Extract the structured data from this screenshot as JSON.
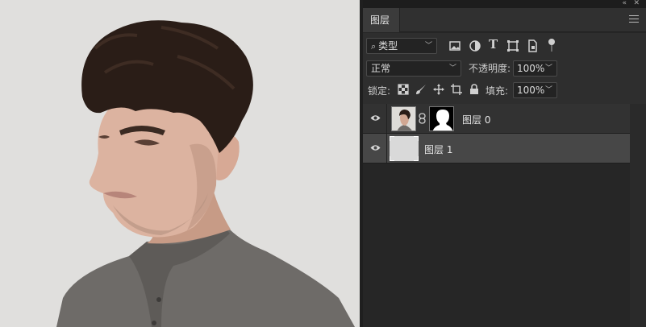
{
  "canvas": {
    "background_color": "#e0dfdd",
    "image_subject": "portrait-photo"
  },
  "panel": {
    "header": {
      "collapse_glyph": "«",
      "close_glyph": "✕"
    },
    "tab": {
      "label": "图层"
    },
    "filter": {
      "search_glyph": "⌕",
      "kind_label": "类型",
      "tools": [
        "image-filter-icon",
        "adjustment-filter-icon",
        "type-filter-icon",
        "shape-filter-icon",
        "smart-object-filter-icon"
      ],
      "type_glyph": "T"
    },
    "blend": {
      "mode": "正常",
      "opacity_label": "不透明度:",
      "opacity_value": "100%"
    },
    "lock": {
      "label": "锁定:",
      "icons": [
        "lock-transparent-icon",
        "lock-paint-icon",
        "lock-move-icon",
        "lock-artboard-icon",
        "lock-all-icon"
      ],
      "fill_label": "填充:",
      "fill_value": "100%"
    },
    "layers": [
      {
        "name": "图层 0",
        "visible": true,
        "has_mask": true,
        "selected": false
      },
      {
        "name": "图层 1",
        "visible": true,
        "has_mask": false,
        "selected": true
      }
    ]
  },
  "colors": {
    "panel_bg": "#262626",
    "selected_layer": "#474747",
    "canvas_bg": "#e0dfdd"
  }
}
